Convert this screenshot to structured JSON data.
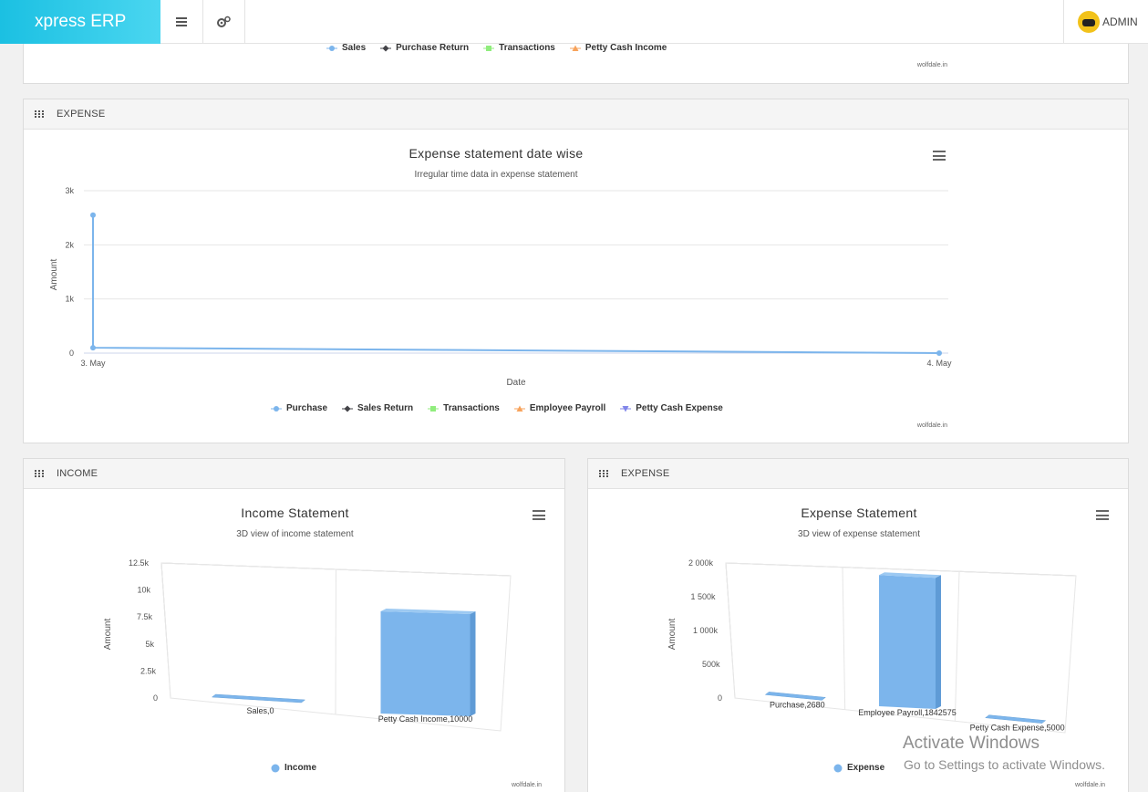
{
  "app": {
    "brand": "xpress ERP",
    "user_label": "ADMIN"
  },
  "top_panel": {
    "legend": [
      "Sales",
      "Purchase Return",
      "Transactions",
      "Petty Cash Income"
    ],
    "credit": "wolfdale.in"
  },
  "expense_line_panel": {
    "header": "EXPENSE",
    "credit": "wolfdale.in",
    "chart_data": {
      "type": "line",
      "title": "Expense statement date wise",
      "subtitle": "Irregular time data in expense statement",
      "xlabel": "Date",
      "ylabel": "Amount",
      "x_ticks": [
        "3. May",
        "4. May"
      ],
      "y_ticks": [
        "0",
        "1k",
        "2k",
        "3k"
      ],
      "ylim": [
        0,
        3000
      ],
      "series": [
        {
          "name": "Purchase",
          "points": [
            [
              "3. May",
              2550
            ],
            [
              "3. May",
              100
            ],
            [
              "4. May",
              0
            ]
          ]
        },
        {
          "name": "Sales Return",
          "points": []
        },
        {
          "name": "Transactions",
          "points": []
        },
        {
          "name": "Employee Payroll",
          "points": []
        },
        {
          "name": "Petty Cash Expense",
          "points": []
        }
      ],
      "legend_position": "bottom"
    }
  },
  "income_panel": {
    "header": "INCOME",
    "credit": "wolfdale.in",
    "chart_data": {
      "type": "bar",
      "title": "Income Statement",
      "subtitle": "3D view of income statement",
      "ylabel": "Amount",
      "y_ticks": [
        "0",
        "2.5k",
        "5k",
        "7.5k",
        "10k",
        "12.5k"
      ],
      "ylim": [
        0,
        12500
      ],
      "categories": [
        "Sales",
        "Petty Cash Income"
      ],
      "data_labels": [
        "Sales,0",
        "Petty Cash Income,10000"
      ],
      "series": [
        {
          "name": "Income",
          "values": [
            0,
            10000
          ]
        }
      ],
      "legend_position": "bottom"
    }
  },
  "expense_bar_panel": {
    "header": "EXPENSE",
    "credit": "wolfdale.in",
    "chart_data": {
      "type": "bar",
      "title": "Expense Statement",
      "subtitle": "3D view of expense statement",
      "ylabel": "Amount",
      "y_ticks": [
        "0",
        "500k",
        "1 000k",
        "1 500k",
        "2 000k"
      ],
      "ylim": [
        0,
        2000000
      ],
      "categories": [
        "Purchase",
        "Employee Payroll",
        "Petty Cash Expense"
      ],
      "data_labels": [
        "Purchase,2680",
        "Employee Payroll,1842575",
        "Petty Cash Expense,5000"
      ],
      "series": [
        {
          "name": "Expense",
          "values": [
            2680,
            1842575,
            5000
          ]
        }
      ],
      "legend_position": "bottom"
    }
  },
  "os_watermark": {
    "line1": "Activate Windows",
    "line2": "Go to Settings to activate Windows."
  },
  "colors": {
    "series1": "#7cb5ec",
    "series2": "#434348",
    "series3": "#90ed7d",
    "series4": "#f7a35c",
    "series5": "#8085e9",
    "brand": "#1bc0e2"
  }
}
